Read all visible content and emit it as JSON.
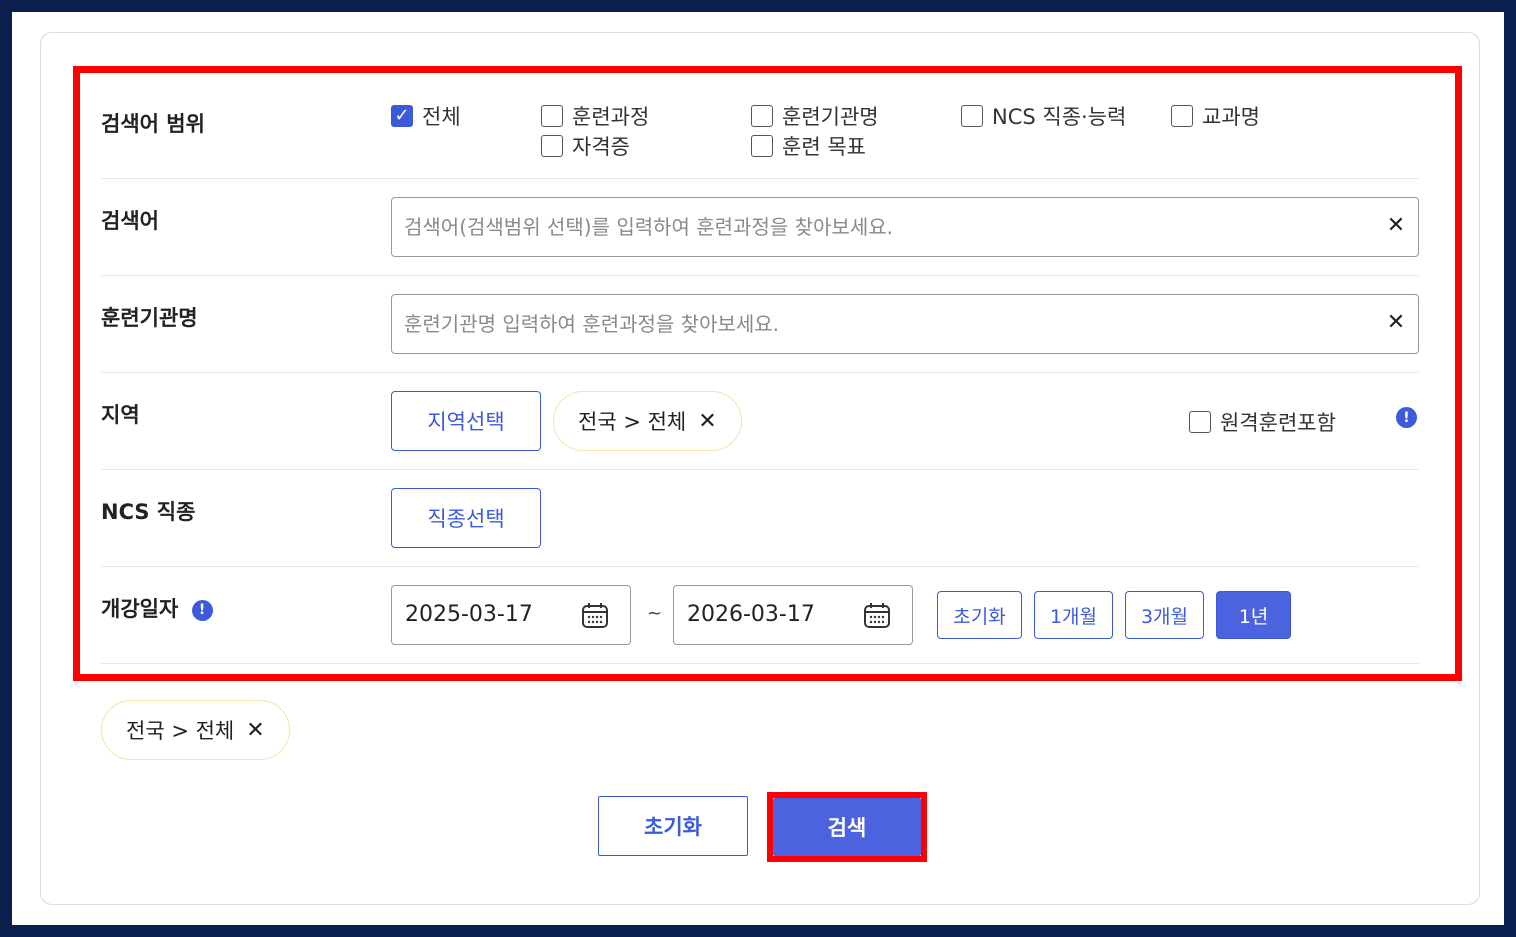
{
  "scope": {
    "label": "검색어 범위",
    "options": [
      {
        "label": "전체",
        "checked": true
      },
      {
        "label": "훈련과정",
        "checked": false
      },
      {
        "label": "자격증",
        "checked": false
      },
      {
        "label": "훈련기관명",
        "checked": false
      },
      {
        "label": "훈련 목표",
        "checked": false
      },
      {
        "label": "NCS 직종·능력",
        "checked": false
      },
      {
        "label": "교과명",
        "checked": false
      }
    ]
  },
  "keyword": {
    "label": "검색어",
    "placeholder": "검색어(검색범위 선택)를 입력하여 훈련과정을 찾아보세요.",
    "clear": "✕"
  },
  "institution": {
    "label": "훈련기관명",
    "placeholder": "훈련기관명 입력하여 훈련과정을 찾아보세요.",
    "clear": "✕"
  },
  "region": {
    "label": "지역",
    "select_button": "지역선택",
    "chip": "전국 > 전체",
    "chip_remove": "✕",
    "remote_label": "원격훈련포함",
    "remote_checked": false,
    "info": "!"
  },
  "ncs": {
    "label": "NCS 직종",
    "select_button": "직종선택"
  },
  "open_date": {
    "label": "개강일자",
    "info": "!",
    "start": "2025-03-17",
    "separator": "~",
    "end": "2026-03-17",
    "periods": [
      {
        "label": "초기화",
        "active": false
      },
      {
        "label": "1개월",
        "active": false
      },
      {
        "label": "3개월",
        "active": false
      },
      {
        "label": "1년",
        "active": true
      }
    ]
  },
  "selected_chip": {
    "label": "전국 > 전체",
    "remove": "✕"
  },
  "actions": {
    "reset": "초기화",
    "search": "검색"
  },
  "colors": {
    "accent": "#4c63e0",
    "highlight": "#ff0000",
    "frame": "#0b1f4f",
    "chip_border": "#f2e6a8"
  }
}
